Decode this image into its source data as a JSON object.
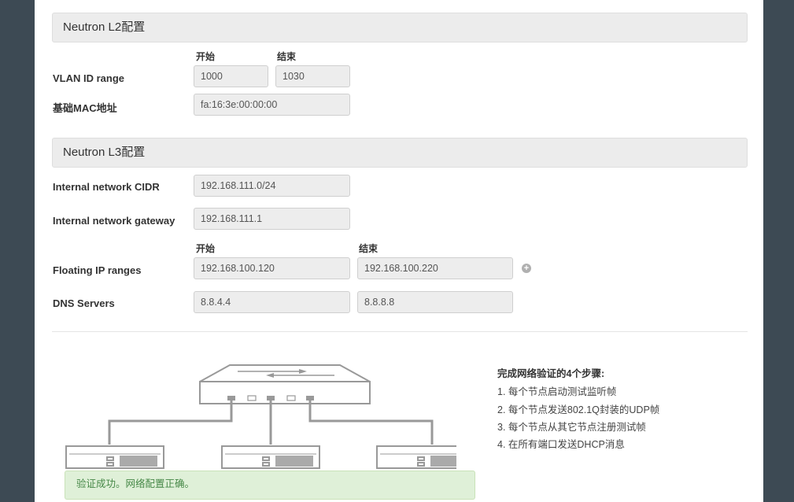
{
  "l2": {
    "header": "Neutron L2配置",
    "start_label": "开始",
    "end_label": "结束",
    "vlan_label": "VLAN ID range",
    "vlan_start": "1000",
    "vlan_end": "1030",
    "mac_label": "基础MAC地址",
    "mac_value": "fa:16:3e:00:00:00"
  },
  "l3": {
    "header": "Neutron L3配置",
    "cidr_label": "Internal network CIDR",
    "cidr_value": "192.168.111.0/24",
    "gateway_label": "Internal network gateway",
    "gateway_value": "192.168.111.1",
    "start_label": "开始",
    "end_label": "结束",
    "floating_label": "Floating IP ranges",
    "floating_start": "192.168.100.120",
    "floating_end": "192.168.100.220",
    "dns_label": "DNS Servers",
    "dns_1": "8.8.4.4",
    "dns_2": "8.8.8.8"
  },
  "verification": {
    "title": "完成网络验证的4个步骤:",
    "steps": [
      "1. 每个节点启动测试监听帧",
      "2. 每个节点发送802.1Q封装的UDP帧",
      "3. 每个节点从其它节点注册测试帧",
      "4. 在所有端口发送DHCP消息"
    ],
    "success_message": "验证成功。网络配置正确。"
  },
  "icons": {
    "add": "plus-circle-icon",
    "switch": "network-switch-icon",
    "node": "server-node-icon"
  },
  "colors": {
    "success_bg": "#dff0d8",
    "success_text": "#468847",
    "diagram_line": "#999999"
  }
}
